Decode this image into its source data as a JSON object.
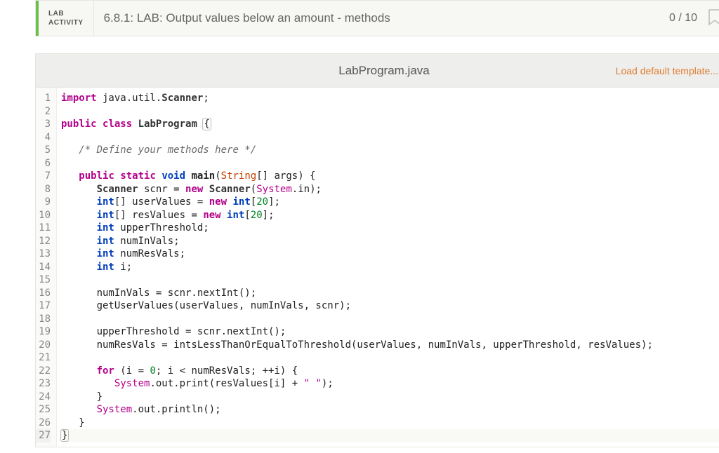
{
  "header": {
    "lab_line1": "LAB",
    "lab_line2": "ACTIVITY",
    "title": "6.8.1: LAB: Output values below an amount - methods",
    "score": "0 / 10"
  },
  "file_bar": {
    "filename": "LabProgram.java",
    "load_template": "Load default template..."
  },
  "code": {
    "line_count": 27,
    "lines_html": [
      "<span class='kw'>import</span> java.util.<span class='id'>Scanner</span>;",
      "",
      "<span class='kw'>public</span> <span class='kw'>class</span> <span class='id'>LabProgram</span> <span class='paren-hl'>{</span>",
      "",
      "   <span class='com'>/* Define your methods here */</span>",
      "",
      "   <span class='kw'>public</span> <span class='kw'>static</span> <span class='kw2'>void</span> <span class='fn'>main</span>(<span class='type'>String</span>[] args) {",
      "      <span class='id'>Scanner</span> scnr = <span class='kw'>new</span> <span class='id'>Scanner</span>(<span class='lib'>System</span>.in);",
      "      <span class='kw2'>int</span>[] userValues = <span class='kw'>new</span> <span class='kw2'>int</span>[<span class='num'>20</span>];",
      "      <span class='kw2'>int</span>[] resValues = <span class='kw'>new</span> <span class='kw2'>int</span>[<span class='num'>20</span>];",
      "      <span class='kw2'>int</span> upperThreshold;",
      "      <span class='kw2'>int</span> numInVals;",
      "      <span class='kw2'>int</span> numResVals;",
      "      <span class='kw2'>int</span> i;",
      "",
      "      numInVals = scnr.nextInt();",
      "      getUserValues(userValues, numInVals, scnr);",
      "",
      "      upperThreshold = scnr.nextInt();",
      "      numResVals = intsLessThanOrEqualToThreshold(userValues, numInVals, upperThreshold, resValues);",
      "",
      "      <span class='kw'>for</span> (i = <span class='num'>0</span>; i &lt; numResVals; ++i) {",
      "         <span class='lib'>System</span>.out.print(resValues[i] + <span class='str'>\" \"</span>);",
      "      }",
      "      <span class='lib'>System</span>.out.println();",
      "   }",
      "<span class='paren-hl'>}</span>"
    ]
  }
}
